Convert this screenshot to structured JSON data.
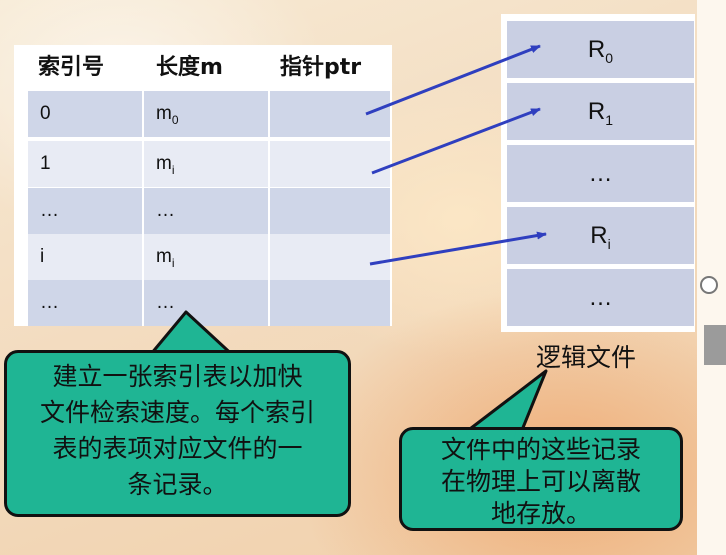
{
  "index_table": {
    "headers": [
      "索引号",
      "长度m",
      "指针ptr"
    ],
    "rows": [
      {
        "index": "0",
        "length_base": "m",
        "length_sub": "0",
        "ptr": ""
      },
      {
        "index": "1",
        "length_base": "m",
        "length_sub": "i",
        "ptr": ""
      },
      {
        "index": "…",
        "length_base": "…",
        "length_sub": "",
        "ptr": ""
      },
      {
        "index": "i",
        "length_base": "m",
        "length_sub": "i",
        "ptr": ""
      },
      {
        "index": "…",
        "length_base": "…",
        "length_sub": "",
        "ptr": ""
      }
    ]
  },
  "logical_file": {
    "records": [
      {
        "base": "R",
        "sub": "0"
      },
      {
        "base": "R",
        "sub": "1"
      },
      {
        "base": "…",
        "sub": ""
      },
      {
        "base": "R",
        "sub": "i"
      },
      {
        "base": "…",
        "sub": ""
      }
    ],
    "caption": "逻辑文件"
  },
  "callouts": {
    "left": {
      "lines": [
        "建立一张索引表以加快",
        "文件检索速度。每个索引",
        "表的表项对应文件的一",
        "条记录。"
      ]
    },
    "right": {
      "lines": [
        "文件中的这些记录",
        "在物理上可以离散",
        "地存放。"
      ]
    }
  },
  "colors": {
    "callout_fill": "#1fb594",
    "arrow": "#2f3fbf",
    "row_dark": "#cfd6e8",
    "row_light": "#e8ebf4",
    "record_fill": "#c9cfe3"
  }
}
